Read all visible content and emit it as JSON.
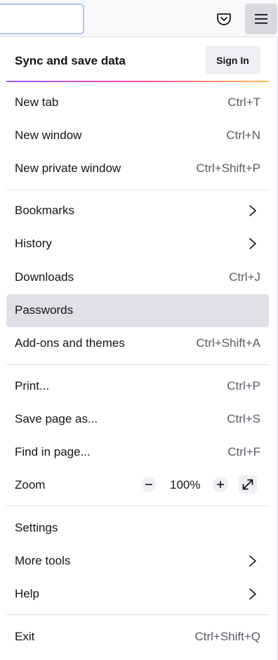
{
  "toolbar": {
    "pocket_icon": "pocket-icon",
    "menu_icon": "hamburger-menu-icon"
  },
  "sync": {
    "title": "Sync and save data",
    "sign_in": "Sign In"
  },
  "menu": {
    "new_tab": {
      "label": "New tab",
      "shortcut": "Ctrl+T"
    },
    "new_window": {
      "label": "New window",
      "shortcut": "Ctrl+N"
    },
    "new_private_window": {
      "label": "New private window",
      "shortcut": "Ctrl+Shift+P"
    },
    "bookmarks": {
      "label": "Bookmarks"
    },
    "history": {
      "label": "History"
    },
    "downloads": {
      "label": "Downloads",
      "shortcut": "Ctrl+J"
    },
    "passwords": {
      "label": "Passwords"
    },
    "addons": {
      "label": "Add-ons and themes",
      "shortcut": "Ctrl+Shift+A"
    },
    "print": {
      "label": "Print...",
      "shortcut": "Ctrl+P"
    },
    "save_page": {
      "label": "Save page as...",
      "shortcut": "Ctrl+S"
    },
    "find": {
      "label": "Find in page...",
      "shortcut": "Ctrl+F"
    },
    "zoom": {
      "label": "Zoom",
      "value": "100%"
    },
    "settings": {
      "label": "Settings"
    },
    "more_tools": {
      "label": "More tools"
    },
    "help": {
      "label": "Help"
    },
    "exit": {
      "label": "Exit",
      "shortcut": "Ctrl+Shift+Q"
    }
  },
  "colors": {
    "highlight": "#e0e0e6",
    "accent_gradient": [
      "#9059ff",
      "#ff4aa2",
      "#ffbd4f"
    ]
  }
}
